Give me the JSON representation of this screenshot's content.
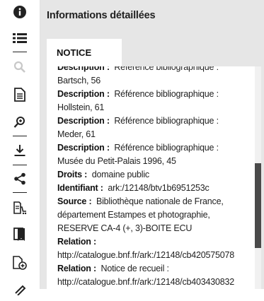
{
  "panel": {
    "title": "Informations détaillées",
    "tab_label": "NOTICE"
  },
  "scroll": {
    "position_fraction": 0.6
  },
  "sidebar": {
    "icons": [
      "info-icon",
      "list-icon",
      "search-icon",
      "document-icon",
      "zoom-in-icon",
      "download-icon",
      "share-icon",
      "cart-icon",
      "bookmark-icon",
      "add-document-icon",
      "pen-icon"
    ]
  },
  "record": {
    "lines": [
      {
        "label": "Description :",
        "text": "Référence bibliographique :"
      },
      {
        "label": "",
        "text": "Bartsch, 56"
      },
      {
        "label": "Description :",
        "text": "Référence bibliographique :"
      },
      {
        "label": "",
        "text": "Hollstein, 61"
      },
      {
        "label": "Description :",
        "text": "Référence bibliographique :"
      },
      {
        "label": "",
        "text": "Meder, 61"
      },
      {
        "label": "Description :",
        "text": "Référence bibliographique :"
      },
      {
        "label": "",
        "text": "Musée du Petit-Palais 1996, 45"
      },
      {
        "label": "Droits :",
        "text": "domaine public"
      },
      {
        "label": "Identifiant :",
        "text": "ark:/12148/btv1b6951253c"
      },
      {
        "label": "Source :",
        "text": "Bibliothèque nationale de France,"
      },
      {
        "label": "",
        "text": "département Estampes et photographie,"
      },
      {
        "label": "",
        "text": "RESERVE CA-4 (+, 3)-BOITE ECU"
      },
      {
        "label": "Relation :",
        "text": ""
      },
      {
        "label": "",
        "text": "http://catalogue.bnf.fr/ark:/12148/cb420575078"
      },
      {
        "label": "Relation :",
        "text": "Notice de recueil :"
      },
      {
        "label": "",
        "text": "http://catalogue.bnf.fr/ark:/12148/cb403430832"
      }
    ]
  }
}
